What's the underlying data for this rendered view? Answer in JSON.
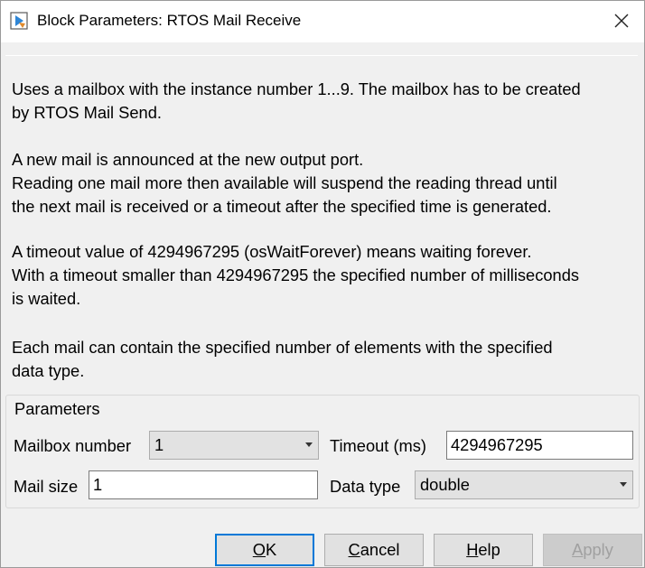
{
  "window": {
    "title": "Block Parameters: RTOS Mail Receive"
  },
  "description": {
    "lines": [
      "Uses a mailbox with the instance number 1...9. The mailbox has to be created",
      "by RTOS Mail Send.",
      "A new mail is announced at the new output port.",
      "Reading one mail more then available will suspend the reading thread until",
      "the next mail is received or a timeout after the specified time is generated.",
      "A timeout value of 4294967295 (osWaitForever) means waiting forever.",
      "With a timeout smaller than 4294967295 the specified number of milliseconds",
      "is waited.",
      "Each mail can contain the specified number of elements with the specified",
      "data type."
    ]
  },
  "parameters": {
    "title": "Parameters",
    "mailbox_number": {
      "label": "Mailbox number",
      "value": "1"
    },
    "timeout": {
      "label": "Timeout (ms)",
      "value": "4294967295"
    },
    "mail_size": {
      "label": "Mail size",
      "value": "1"
    },
    "data_type": {
      "label": "Data type",
      "value": "double"
    }
  },
  "buttons": {
    "ok": {
      "first": "O",
      "rest": "K"
    },
    "cancel": {
      "first": "C",
      "rest": "ancel"
    },
    "help": {
      "first": "H",
      "rest": "elp"
    },
    "apply": {
      "first": "A",
      "rest": "pply"
    }
  },
  "icons": {
    "app": "simulink-block-icon",
    "close": "close-icon",
    "dropdown": "chevron-down-icon"
  }
}
